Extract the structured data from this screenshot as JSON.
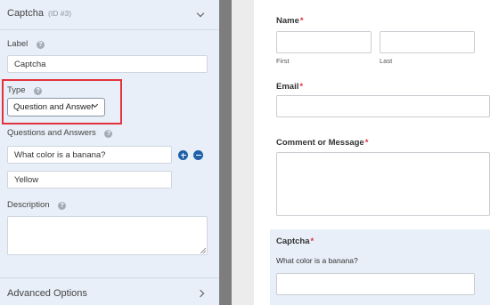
{
  "panel": {
    "title": "Captcha",
    "id_label": "(ID #3)",
    "label_field": {
      "label": "Label",
      "value": "Captcha"
    },
    "type_field": {
      "label": "Type",
      "selected": "Question and Answer"
    },
    "qa": {
      "label": "Questions and Answers",
      "question": "What color is a banana?",
      "answer": "Yellow"
    },
    "description": {
      "label": "Description",
      "value": ""
    },
    "advanced": {
      "label": "Advanced Options"
    },
    "help_glyph": "?"
  },
  "preview": {
    "name": {
      "label": "Name",
      "required": "*",
      "first": "First",
      "last": "Last"
    },
    "email": {
      "label": "Email",
      "required": "*"
    },
    "comment": {
      "label": "Comment or Message",
      "required": "*"
    },
    "captcha": {
      "label": "Captcha",
      "required": "*",
      "question": "What color is a banana?"
    }
  },
  "colors": {
    "panel_bg": "#e8eff8",
    "highlight": "#e2323b",
    "accent_blue": "#2060a8",
    "divider": "#7d7d7d",
    "required": "#e2323b"
  },
  "icons": [
    "chevron-down-icon",
    "help-icon",
    "add-icon",
    "remove-icon",
    "chevron-right-icon",
    "resize-grip-icon"
  ]
}
